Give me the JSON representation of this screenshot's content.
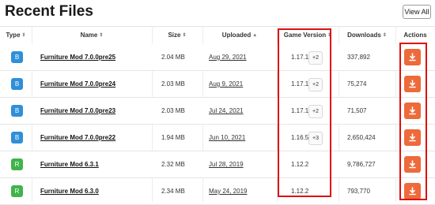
{
  "header": {
    "title": "Recent Files",
    "view_all_label": "View All"
  },
  "columns": {
    "type": "Type",
    "name": "Name",
    "size": "Size",
    "uploaded": "Uploaded",
    "game_version": "Game Version",
    "downloads": "Downloads",
    "actions": "Actions"
  },
  "colors": {
    "beta": "#2f8fd8",
    "release": "#3fb44a",
    "action": "#ee6a3a",
    "highlight": "#e01010"
  },
  "rows": [
    {
      "type": "B",
      "name": "Furniture Mod 7.0.0pre25",
      "size": "2.04 MB",
      "uploaded": "Aug 29, 2021",
      "version": "1.17.1",
      "extra": "+2",
      "downloads": "337,892"
    },
    {
      "type": "B",
      "name": "Furniture Mod 7.0.0pre24",
      "size": "2.03 MB",
      "uploaded": "Aug 9, 2021",
      "version": "1.17.1",
      "extra": "+2",
      "downloads": "75,274"
    },
    {
      "type": "B",
      "name": "Furniture Mod 7.0.0pre23",
      "size": "2.03 MB",
      "uploaded": "Jul 24, 2021",
      "version": "1.17.1",
      "extra": "+2",
      "downloads": "71,507"
    },
    {
      "type": "B",
      "name": "Furniture Mod 7.0.0pre22",
      "size": "1.94 MB",
      "uploaded": "Jun 10, 2021",
      "version": "1.16.5",
      "extra": "+3",
      "downloads": "2,650,424"
    },
    {
      "type": "R",
      "name": "Furniture Mod 6.3.1",
      "size": "2.32 MB",
      "uploaded": "Jul 28, 2019",
      "version": "1.12.2",
      "extra": "",
      "downloads": "9,786,727"
    },
    {
      "type": "R",
      "name": "Furniture Mod 6.3.0",
      "size": "2.34 MB",
      "uploaded": "May 24, 2019",
      "version": "1.12.2",
      "extra": "",
      "downloads": "793,770"
    }
  ],
  "icons": {
    "sort": "sort-arrows-icon",
    "download": "download-icon"
  }
}
